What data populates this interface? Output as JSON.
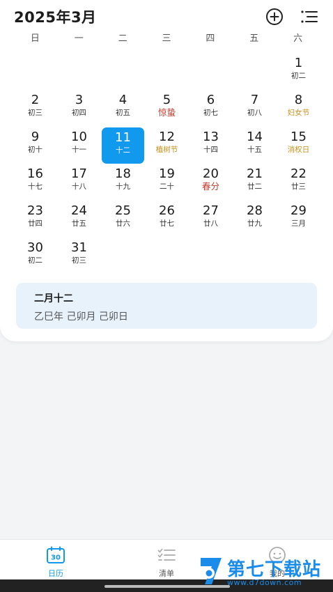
{
  "header": {
    "title": "2025年3月",
    "add_icon": "add-circle-icon",
    "menu_icon": "list-menu-icon"
  },
  "weekdays": [
    "日",
    "一",
    "二",
    "三",
    "四",
    "五",
    "六"
  ],
  "days": [
    {
      "num": "",
      "lunar": ""
    },
    {
      "num": "",
      "lunar": ""
    },
    {
      "num": "",
      "lunar": ""
    },
    {
      "num": "",
      "lunar": ""
    },
    {
      "num": "",
      "lunar": ""
    },
    {
      "num": "",
      "lunar": ""
    },
    {
      "num": "1",
      "lunar": "初二",
      "type": "normal"
    },
    {
      "num": "2",
      "lunar": "初三",
      "type": "normal"
    },
    {
      "num": "3",
      "lunar": "初四",
      "type": "normal"
    },
    {
      "num": "4",
      "lunar": "初五",
      "type": "normal"
    },
    {
      "num": "5",
      "lunar": "惊蛰",
      "type": "term"
    },
    {
      "num": "6",
      "lunar": "初七",
      "type": "normal"
    },
    {
      "num": "7",
      "lunar": "初八",
      "type": "normal"
    },
    {
      "num": "8",
      "lunar": "妇女节",
      "type": "holiday"
    },
    {
      "num": "9",
      "lunar": "初十",
      "type": "normal"
    },
    {
      "num": "10",
      "lunar": "十一",
      "type": "normal"
    },
    {
      "num": "11",
      "lunar": "十二",
      "type": "selected"
    },
    {
      "num": "12",
      "lunar": "植树节",
      "type": "holiday"
    },
    {
      "num": "13",
      "lunar": "十四",
      "type": "normal"
    },
    {
      "num": "14",
      "lunar": "十五",
      "type": "normal"
    },
    {
      "num": "15",
      "lunar": "消权日",
      "type": "holiday"
    },
    {
      "num": "16",
      "lunar": "十七",
      "type": "normal"
    },
    {
      "num": "17",
      "lunar": "十八",
      "type": "normal"
    },
    {
      "num": "18",
      "lunar": "十九",
      "type": "normal"
    },
    {
      "num": "19",
      "lunar": "二十",
      "type": "normal"
    },
    {
      "num": "20",
      "lunar": "春分",
      "type": "term"
    },
    {
      "num": "21",
      "lunar": "廿二",
      "type": "normal"
    },
    {
      "num": "22",
      "lunar": "廿三",
      "type": "normal"
    },
    {
      "num": "23",
      "lunar": "廿四",
      "type": "normal"
    },
    {
      "num": "24",
      "lunar": "廿五",
      "type": "normal"
    },
    {
      "num": "25",
      "lunar": "廿六",
      "type": "normal"
    },
    {
      "num": "26",
      "lunar": "廿七",
      "type": "normal"
    },
    {
      "num": "27",
      "lunar": "廿八",
      "type": "normal"
    },
    {
      "num": "28",
      "lunar": "廿九",
      "type": "normal"
    },
    {
      "num": "29",
      "lunar": "三月",
      "type": "normal"
    },
    {
      "num": "30",
      "lunar": "初二",
      "type": "normal"
    },
    {
      "num": "31",
      "lunar": "初三",
      "type": "normal"
    }
  ],
  "info": {
    "lunar_date": "二月十二",
    "ganzhi": "乙巳年 己卯月 己卯日"
  },
  "nav": {
    "calendar_label": "日历",
    "calendar_icon_text": "30",
    "list_label": "清单",
    "me_label": "我的"
  },
  "watermark": {
    "title": "第七下载站",
    "url": "www.d7down.com"
  },
  "colors": {
    "accent": "#1199ee",
    "holiday": "#c7901a",
    "solar_term": "#c23a2b",
    "info_bg": "#e7f2fb"
  }
}
